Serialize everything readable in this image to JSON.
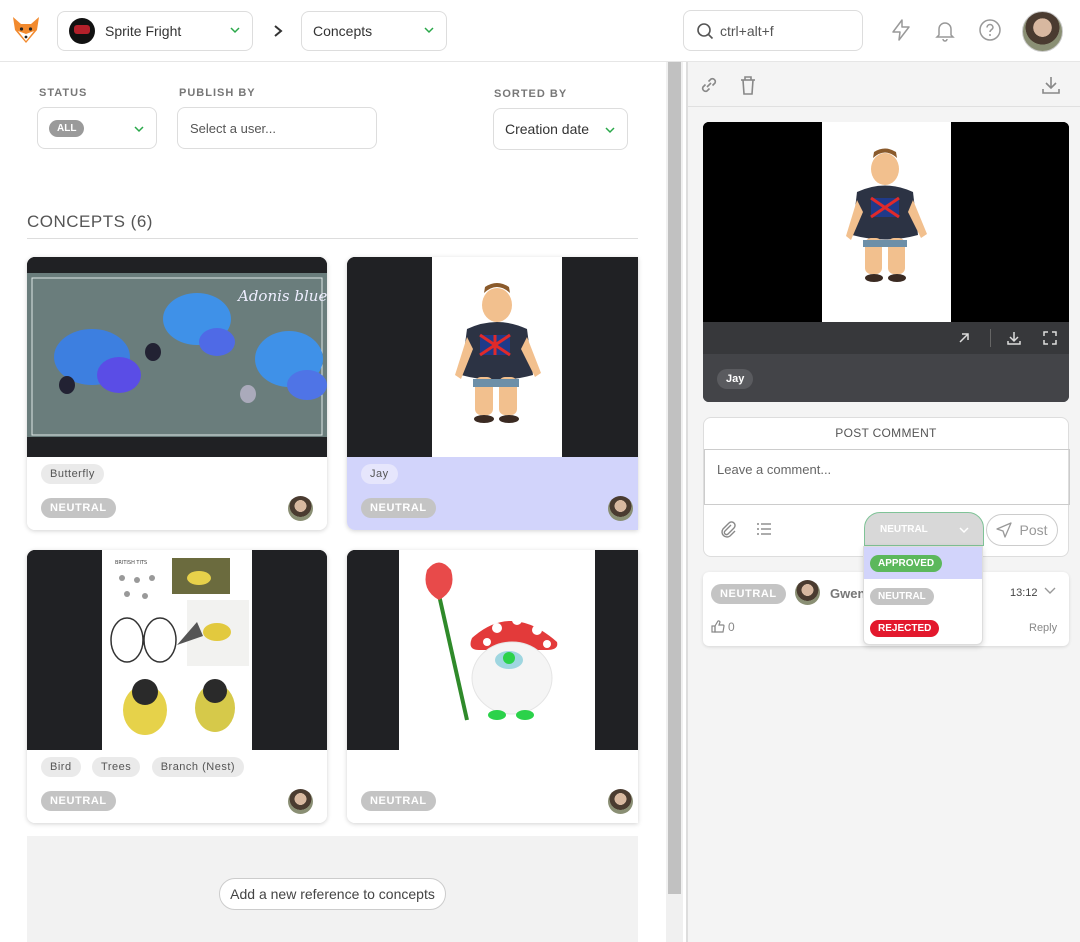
{
  "topbar": {
    "production": "Sprite Fright",
    "section": "Concepts",
    "search_placeholder": "ctrl+alt+f"
  },
  "filters": {
    "status_label": "STATUS",
    "status_value": "ALL",
    "publish_label": "PUBLISH BY",
    "publish_placeholder": "Select a user...",
    "sorted_label": "SORTED BY",
    "sorted_value": "Creation date"
  },
  "concepts": {
    "title": "CONCEPTS (6)",
    "cards": [
      {
        "thumbnail": "butterfly-sketch",
        "thumb_text": "Adonis blue",
        "tags": [
          "Butterfly"
        ],
        "status": "NEUTRAL",
        "selected": false
      },
      {
        "thumbnail": "jay-character",
        "tags": [
          "Jay"
        ],
        "status": "NEUTRAL",
        "selected": true
      },
      {
        "thumbnail": "bird-sketches",
        "thumb_text": "BRITISH TITS",
        "tags": [
          "Bird",
          "Trees",
          "Branch (Nest)"
        ],
        "status": "NEUTRAL",
        "selected": false
      },
      {
        "thumbnail": "mushroom-rose",
        "tags": [],
        "status": "NEUTRAL",
        "selected": false
      }
    ],
    "add_button": "Add a new reference to concepts"
  },
  "preview": {
    "tag": "Jay"
  },
  "comment": {
    "title": "POST COMMENT",
    "placeholder": "Leave a comment...",
    "status_selected": "NEUTRAL",
    "post_label": "Post",
    "status_options": [
      {
        "label": "APPROVED",
        "color": "#5cb85c",
        "highlighted": true
      },
      {
        "label": "NEUTRAL",
        "color": "#c4c4c4",
        "highlighted": false
      },
      {
        "label": "REJECTED",
        "color": "#e3182d",
        "highlighted": false
      }
    ]
  },
  "comments": [
    {
      "status": "NEUTRAL",
      "author": "Gwen",
      "time": "13:12",
      "likes": "0",
      "reply": "Reply"
    }
  ],
  "colors": {
    "accent_green": "#5cb85c",
    "selected_card": "#d2d4fb",
    "rejected": "#e3182d"
  }
}
